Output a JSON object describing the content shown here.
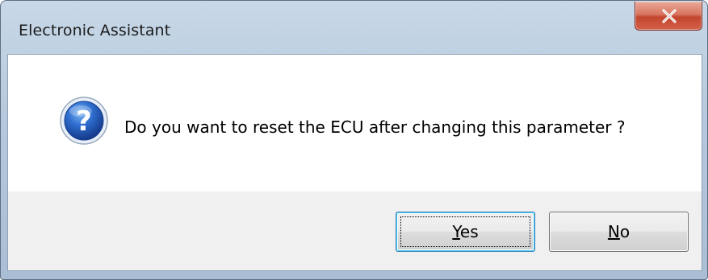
{
  "window": {
    "title": "Electronic Assistant",
    "close_icon": "close-icon"
  },
  "dialog": {
    "icon": "question-icon",
    "message": "Do you want to reset the ECU after changing this parameter ?"
  },
  "buttons": {
    "yes": {
      "mnemonic": "Y",
      "rest": "es"
    },
    "no": {
      "mnemonic": "N",
      "rest": "o"
    }
  },
  "colors": {
    "titlebar": "#b7c9dc",
    "close_button": "#c4452e",
    "icon_blue": "#1f4fa8",
    "footer_bg": "#f0f0f0",
    "focus_border": "#3c7fb1"
  }
}
